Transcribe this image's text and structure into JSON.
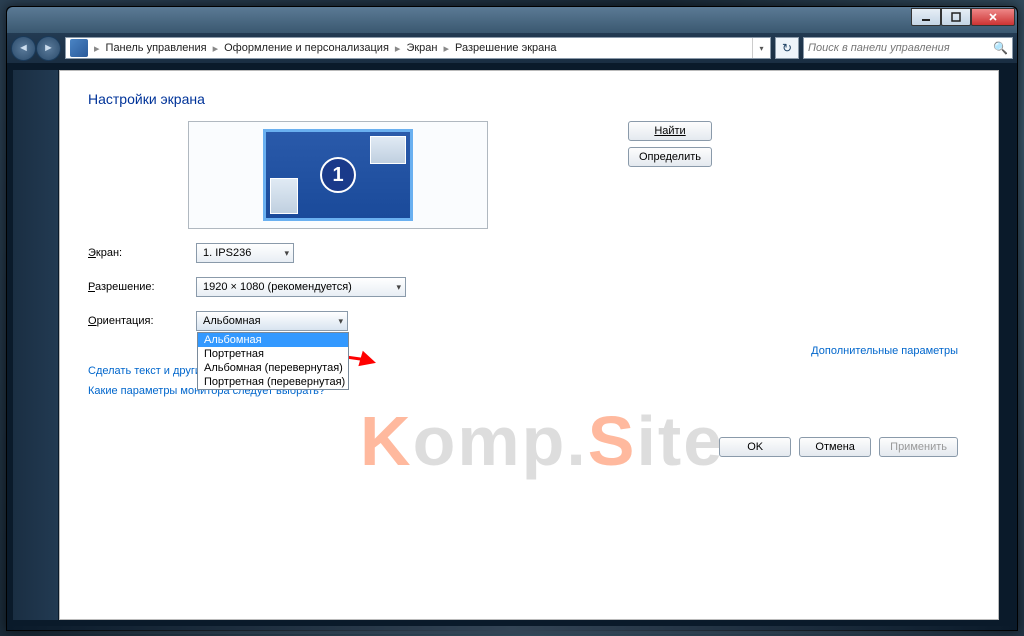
{
  "titlebar": {},
  "breadcrumbs": {
    "items": [
      "Панель управления",
      "Оформление и персонализация",
      "Экран",
      "Разрешение экрана"
    ]
  },
  "search": {
    "placeholder": "Поиск в панели управления"
  },
  "page": {
    "title": "Настройки экрана",
    "monitor_number": "1",
    "btn_find": "Найти",
    "btn_detect": "Определить",
    "label_screen": "Экран:",
    "label_resolution": "Разрешение:",
    "label_orientation": "Ориентация:",
    "screen_value": "1. IPS236",
    "resolution_value": "1920 × 1080 (рекомендуется)",
    "orientation_value": "Альбомная",
    "orientation_options": [
      "Альбомная",
      "Портретная",
      "Альбомная (перевернутая)",
      "Портретная (перевернутая)"
    ],
    "link_text_other": "Сделать текст и другие",
    "link_which_params": "Какие параметры монитора следует выбрать?",
    "link_additional": "Дополнительные параметры",
    "btn_ok": "OK",
    "btn_cancel": "Отмена",
    "btn_apply": "Применить"
  },
  "watermark": {
    "k": "K",
    "omp": "omp.",
    "s": "S",
    "ite": "ite"
  }
}
